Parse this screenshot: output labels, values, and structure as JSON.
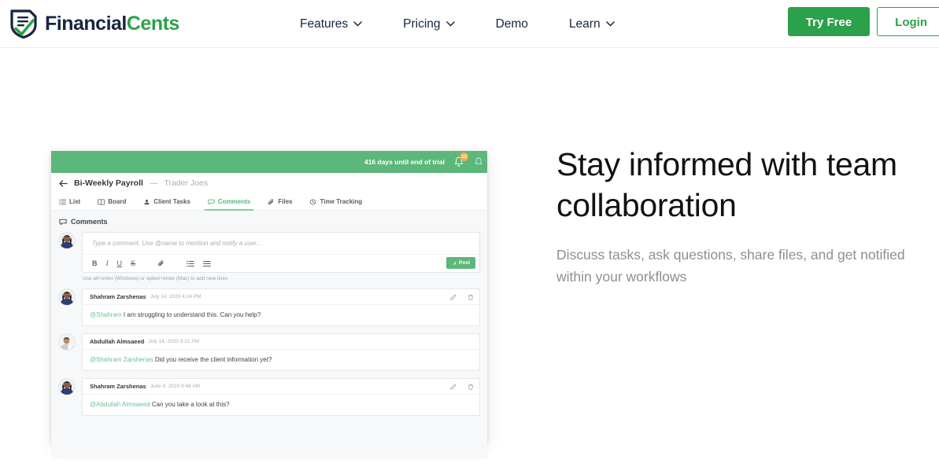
{
  "brand": {
    "icon": "shield-document-check-icon",
    "name_part1": "Financial",
    "name_part2": "Cents"
  },
  "nav": {
    "items": [
      {
        "label": "Features",
        "has_dropdown": true
      },
      {
        "label": "Pricing",
        "has_dropdown": true
      },
      {
        "label": "Demo",
        "has_dropdown": false
      },
      {
        "label": "Learn",
        "has_dropdown": true
      }
    ],
    "try_free_label": "Try Free",
    "login_label": "Login",
    "accent_green": "#2ca14b",
    "navy": "#15263f"
  },
  "hero": {
    "title": "Stay informed with team collaboration",
    "title_line1": "Stay informed with team",
    "title_line2": "collaboration",
    "subtitle_line1": "Discuss tasks, ask questions, share files, and get notified",
    "subtitle_line2": "within your workflows"
  },
  "app": {
    "topbar": {
      "trial_text": "416 days until end of trial",
      "bell_icon": "bell-icon",
      "notification_count": "12",
      "badge_color": "#f0ad4e",
      "bar_color": "#5cb87a"
    },
    "breadcrumb": {
      "back_icon": "arrow-left-icon",
      "title": "Bi-Weekly Payroll",
      "separator": "—",
      "client": "Trader Joes"
    },
    "tabs": [
      {
        "label": "List",
        "icon": "list-icon",
        "active": false
      },
      {
        "label": "Board",
        "icon": "board-icon",
        "active": false
      },
      {
        "label": "Client Tasks",
        "icon": "person-icon",
        "active": false
      },
      {
        "label": "Comments",
        "icon": "comment-icon",
        "active": true
      },
      {
        "label": "Files",
        "icon": "paperclip-icon",
        "active": false
      },
      {
        "label": "Time Tracking",
        "icon": "clock-icon",
        "active": false
      }
    ],
    "comments_section": {
      "icon": "comment-icon",
      "label": "Comments"
    },
    "editor": {
      "placeholder": "Type a comment. Use @name to mention and notify a user...",
      "toolbar": [
        {
          "label": "B",
          "name": "bold-button"
        },
        {
          "label": "I",
          "name": "italic-button"
        },
        {
          "label": "U",
          "name": "underline-button"
        },
        {
          "label": "S",
          "name": "strikethrough-button"
        },
        {
          "label": "",
          "name": "attachment-icon"
        },
        {
          "label": "",
          "name": "ordered-list-icon"
        },
        {
          "label": "",
          "name": "unordered-list-icon"
        }
      ],
      "post_label": "Post",
      "post_icon": "send-icon",
      "hint": "Use alt+enter (Windows) or option+enter (Mac) to add new lines"
    },
    "comments": [
      {
        "author": "Shahram Zarshenas",
        "timestamp": "July 14, 2020 4:24 PM",
        "mention": "@Shahram",
        "body": "I am struggling to understand this. Can you help?",
        "has_actions": true,
        "avatar": "avatar-shahram"
      },
      {
        "author": "Abdullah Almsaeed",
        "timestamp": "July 14, 2020 3:21 PM",
        "mention": "@Shahram Zarshenas",
        "body": "Did you receive the client information yet?",
        "has_actions": false,
        "avatar": "avatar-abdullah"
      },
      {
        "author": "Shahram Zarshenas",
        "timestamp": "June 8, 2020 8:48 AM",
        "mention": "@Abdullah Almsaeed",
        "body": "Can you take a look at this?",
        "has_actions": true,
        "avatar": "avatar-shahram"
      }
    ],
    "action_icons": {
      "edit": "pencil-icon",
      "delete": "trash-icon"
    }
  }
}
